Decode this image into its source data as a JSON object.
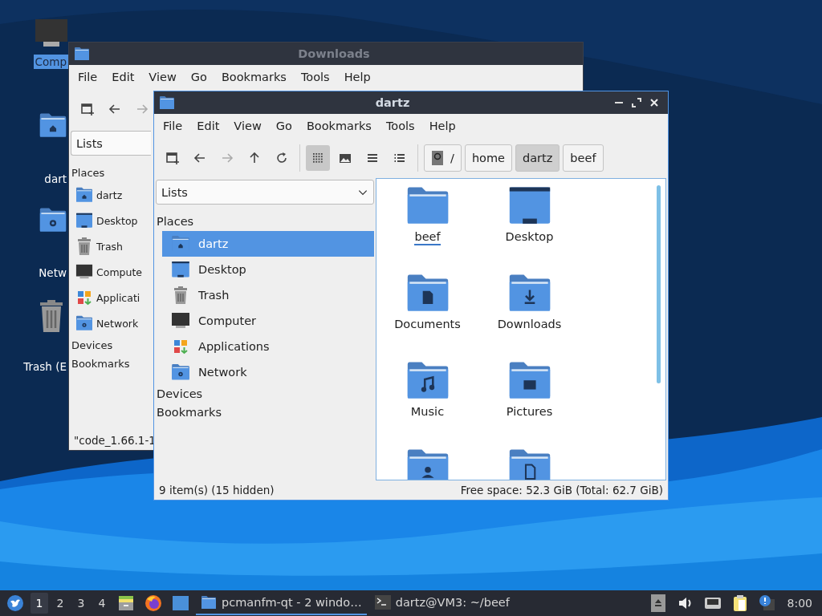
{
  "desktop_icons": [
    {
      "label": "Comp",
      "selected": true
    },
    {
      "label": "dart",
      "selected": false
    },
    {
      "label": "Netw",
      "selected": false
    },
    {
      "label": "Trash (E",
      "selected": false
    }
  ],
  "back_window": {
    "title": "Downloads",
    "menu": [
      "File",
      "Edit",
      "View",
      "Go",
      "Bookmarks",
      "Tools",
      "Help"
    ],
    "view_selector": "Lists",
    "sidebar": {
      "places_title": "Places",
      "places": [
        "dartz",
        "Desktop",
        "Trash",
        "Compute",
        "Applicati",
        "Network"
      ],
      "devices_title": "Devices",
      "bookmarks_title": "Bookmarks"
    },
    "status": "\"code_1.66.1-1"
  },
  "front_window": {
    "title": "dartz",
    "menu": [
      "File",
      "Edit",
      "View",
      "Go",
      "Bookmarks",
      "Tools",
      "Help"
    ],
    "view_modes": [
      {
        "selected": true
      },
      {
        "selected": false
      },
      {
        "selected": false
      },
      {
        "selected": false
      }
    ],
    "path": [
      {
        "label": "/",
        "selected": false
      },
      {
        "label": "home",
        "selected": false
      },
      {
        "label": "dartz",
        "selected": true
      },
      {
        "label": "beef",
        "selected": false
      }
    ],
    "view_selector": "Lists",
    "sidebar": {
      "places_title": "Places",
      "places": [
        {
          "label": "dartz",
          "selected": true
        },
        {
          "label": "Desktop",
          "selected": false
        },
        {
          "label": "Trash",
          "selected": false
        },
        {
          "label": "Computer",
          "selected": false
        },
        {
          "label": "Applications",
          "selected": false
        },
        {
          "label": "Network",
          "selected": false
        }
      ],
      "devices_title": "Devices",
      "bookmarks_title": "Bookmarks"
    },
    "files": [
      {
        "name": "beef",
        "focused": true
      },
      {
        "name": "Desktop",
        "focused": false
      },
      {
        "name": "Documents",
        "focused": false
      },
      {
        "name": "Downloads",
        "focused": false
      },
      {
        "name": "Music",
        "focused": false
      },
      {
        "name": "Pictures",
        "focused": false
      },
      {
        "focused": false
      },
      {
        "focused": false
      }
    ],
    "status": {
      "items": "9 item(s) (15 hidden)",
      "space": "Free space: 52.3 GiB (Total: 62.7 GiB)"
    }
  },
  "taskbar": {
    "desktops": [
      {
        "label": "1",
        "selected": true
      },
      {
        "label": "2",
        "selected": false
      },
      {
        "label": "3",
        "selected": false
      },
      {
        "label": "4",
        "selected": false
      }
    ],
    "tasks": [
      {
        "label": "pcmanfm-qt - 2 windo…",
        "active": true
      },
      {
        "label": "dartz@VM3: ~/beef",
        "active": false
      }
    ],
    "clock": "8:00"
  }
}
